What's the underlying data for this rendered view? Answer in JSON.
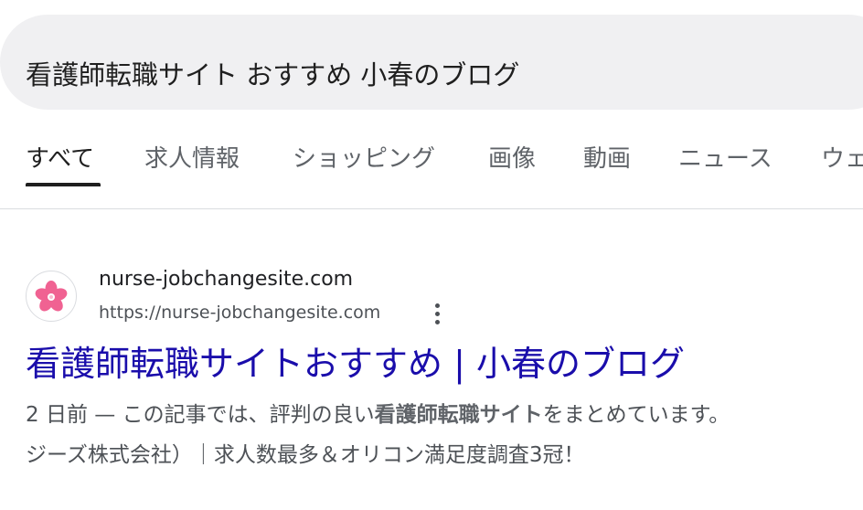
{
  "search": {
    "query": "看護師転職サイト おすすめ 小春のブログ"
  },
  "tabs": [
    {
      "label": "すべて",
      "active": true
    },
    {
      "label": "求人情報"
    },
    {
      "label": "ショッピング"
    },
    {
      "label": "画像"
    },
    {
      "label": "動画"
    },
    {
      "label": "ニュース"
    },
    {
      "label": "ウェ"
    }
  ],
  "result": {
    "favicon": "sakura-flower-icon",
    "site_name": "nurse-jobchangesite.com",
    "url": "https://nurse-jobchangesite.com",
    "more_icon": "vertical-dots-icon",
    "title": "看護師転職サイトおすすめ | 小春のブログ",
    "snippet_date": "2 日前 — ",
    "snippet_text_1": "この記事では、評判の良い",
    "snippet_bold": "看護師転職サイト",
    "snippet_text_2": "をまとめています。",
    "snippet_line2": "ジーズ株式会社）｜求人数最多＆オリコン満足度調査3冠！"
  },
  "colors": {
    "link": "#1a0dab",
    "text": "#1f1f1f",
    "muted": "#5f6368",
    "search_bg": "#f0f0f2",
    "favicon_pink": "#f06292"
  }
}
